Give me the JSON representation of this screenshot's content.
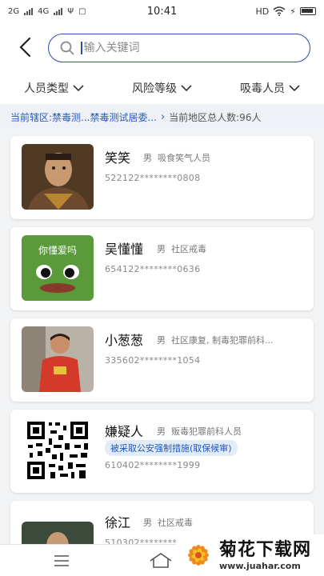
{
  "status_bar": {
    "sim1": "2G",
    "sim2": "4G",
    "time": "10:41",
    "hd": "HD"
  },
  "search": {
    "placeholder": "输入关键词"
  },
  "filters": [
    {
      "label": "人员类型"
    },
    {
      "label": "风险等级"
    },
    {
      "label": "吸毒人员"
    }
  ],
  "district": {
    "label": "当前辖区:禁毒测...禁毒测试居委...",
    "total": "当前地区总人数:96人"
  },
  "people": [
    {
      "name": "笑笑",
      "gender": "男",
      "category": "吸食笑气人员",
      "id_number": "522122********0808"
    },
    {
      "name": "吴懂懂",
      "gender": "男",
      "category": "社区戒毒",
      "id_number": "654122********0636",
      "avatar_text": "你懂爱吗"
    },
    {
      "name": "小葱葱",
      "gender": "男",
      "category": "社区康复, 制毒犯罪前科...",
      "id_number": "335602********1054"
    },
    {
      "name": "嫌疑人",
      "gender": "男",
      "category": "贩毒犯罪前科人员",
      "tag": "被采取公安强制措施(取保候审)",
      "id_number": "610402********1999"
    },
    {
      "name": "徐江",
      "gender": "男",
      "category": "社区戒毒",
      "id_number": "510302********"
    }
  ],
  "watermark": {
    "title": "菊花下载网",
    "url": "www.juahar.com"
  },
  "colors": {
    "accent": "#2a4fa8",
    "link": "#2a5bbd",
    "tag_bg": "#e3ecfb"
  }
}
